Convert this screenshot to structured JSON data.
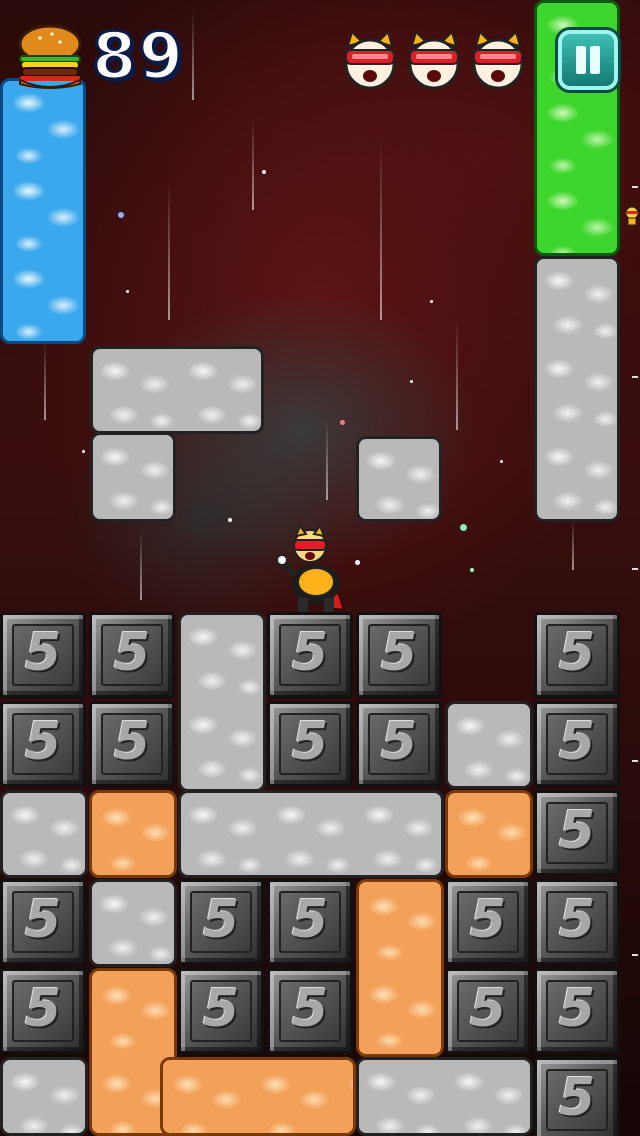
{
  "hud": {
    "score": "89",
    "lives_count": 3,
    "pause_icon": "pause-icon",
    "burger_icon": "burger-icon",
    "life_icon": "hero-face-icon"
  },
  "board": {
    "block_number": "5",
    "colors": {
      "ice": "#3aa8ec",
      "green": "#3ed52c",
      "orange": "#f3a058",
      "stone": "#b9b9b9",
      "metal": "#5a5a5a"
    }
  }
}
